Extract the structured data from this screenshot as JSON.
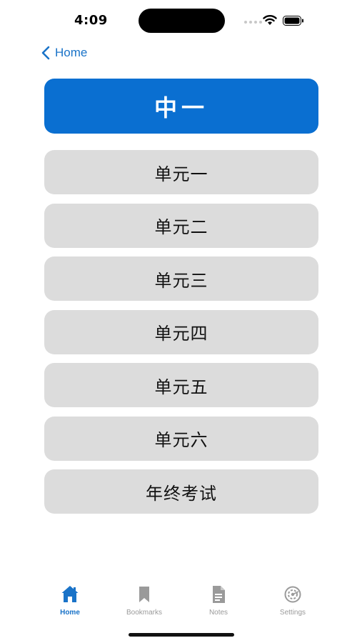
{
  "status_bar": {
    "time": "4:09"
  },
  "nav": {
    "back_label": "Home"
  },
  "title": "中一",
  "units": [
    {
      "label": "单元一"
    },
    {
      "label": "单元二"
    },
    {
      "label": "单元三"
    },
    {
      "label": "单元四"
    },
    {
      "label": "单元五"
    },
    {
      "label": "单元六"
    },
    {
      "label": "年终考试"
    }
  ],
  "tab_bar": {
    "tabs": [
      {
        "label": "Home",
        "icon": "home-icon",
        "active": true
      },
      {
        "label": "Bookmarks",
        "icon": "bookmark-icon",
        "active": false
      },
      {
        "label": "Notes",
        "icon": "notes-icon",
        "active": false
      },
      {
        "label": "Settings",
        "icon": "settings-icon",
        "active": false
      }
    ]
  },
  "colors": {
    "accent": "#0a6fd1",
    "link": "#1a73c8",
    "button_bg": "#dcdcdc",
    "tab_inactive": "#9a9a9a"
  }
}
